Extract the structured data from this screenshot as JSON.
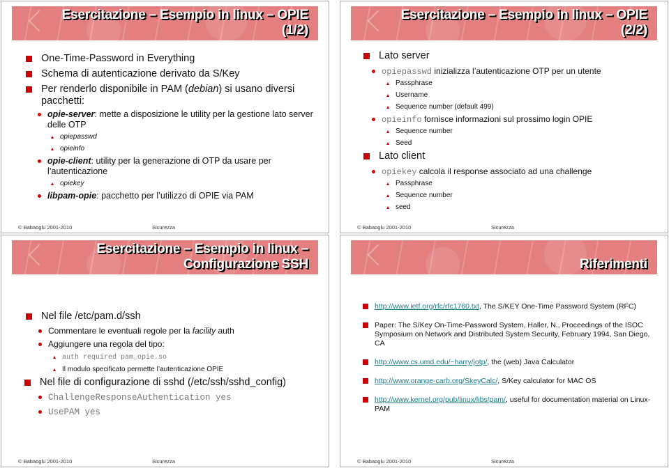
{
  "colors": {
    "title_bar": "#e37f7f",
    "bullet": "#cc0000",
    "link": "#1a7a8a",
    "code_text": "#777777"
  },
  "footer": {
    "copyright": "© Babaoglu 2001-2010",
    "topic": "Sicurezza"
  },
  "slides": [
    {
      "title_line1": "Esercitazione – Esempio in linux – OPIE",
      "title_line2": "(1/2)",
      "bullets": [
        {
          "text": "One-Time-Password in Everything"
        },
        {
          "text": "Schema di autenticazione derivato da S/Key"
        },
        {
          "text_before": "Per renderlo disponibile in PAM (",
          "text_italic": "debian",
          "text_after": ") si usano diversi pacchetti:"
        }
      ],
      "packages": [
        {
          "name": "opie-server",
          "desc": ": mette a disposizione le utility per la gestione lato server delle OTP",
          "items": [
            "opiepasswd",
            "opieinfo"
          ]
        },
        {
          "name": "opie-client",
          "desc": ": utility per la generazione di OTP da usare per l’autenticazione",
          "items": [
            "opiekey"
          ]
        },
        {
          "name": "libpam-opie",
          "desc": ": pacchetto per l’utilizzo di OPIE via PAM",
          "items": []
        }
      ]
    },
    {
      "title_line1": "Esercitazione – Esempio in linux – OPIE",
      "title_line2": "(2/2)",
      "sections": [
        {
          "heading": "Lato server",
          "commands": [
            {
              "cmd": "opiepasswd",
              "desc": " inizializza l’autenticazione OTP per un utente",
              "items": [
                "Passphrase",
                "Username",
                "Sequence number (default 499)"
              ]
            },
            {
              "cmd": "opieinfo",
              "desc": " fornisce informazioni sul prossimo login OPIE",
              "items": [
                "Sequence number",
                "Seed"
              ]
            }
          ]
        },
        {
          "heading": "Lato client",
          "commands": [
            {
              "cmd": "opiekey",
              "desc": " calcola il response associato ad una challenge",
              "items": [
                "Passphrase",
                "Sequence number",
                "seed"
              ]
            }
          ]
        }
      ]
    },
    {
      "title_line1": "Esercitazione – Esempio in linux –",
      "title_line2": "Configurazione SSH",
      "section1": {
        "heading": "Nel file /etc/pam.d/ssh",
        "item1_before": "Commentare le eventuali regole per la ",
        "item1_italic": "facility",
        "item1_after": " auth",
        "item2": "Aggiungere una regola del tipo:",
        "rule_code": "auth required pam_opie.so",
        "rule_note": "Il modulo specificato permette l’autenticazione OPIE"
      },
      "section2": {
        "heading": "Nel file di configurazione di sshd (/etc/ssh/sshd_config)",
        "options": [
          "ChallengeResponseAuthentication yes",
          "UsePAM yes"
        ]
      }
    },
    {
      "title": "Riferimenti",
      "references": [
        {
          "link": "http://www.ietf.org/rfc/rfc1760.txt",
          "text": ", The S/KEY One-Time Password System (RFC)"
        },
        {
          "link": "",
          "text": "Paper: The S/Key On-Time-Password System, Haller, N., Proceedings of the ISOC Symposium on Network and Distributed System Security, February 1994, San Diego, CA"
        },
        {
          "link": "http://www.cs.umd.edu/~harry/jotp/",
          "text": ", the (web) Java Calculator"
        },
        {
          "link": "http://www.orange-carb.org/SkeyCalc/",
          "text": ", S/Key calculator for MAC OS"
        },
        {
          "link": "http://www.kernel.org/pub/linux/libs/pam/",
          "text": ", useful for documentation material on Linux-PAM"
        }
      ]
    }
  ]
}
